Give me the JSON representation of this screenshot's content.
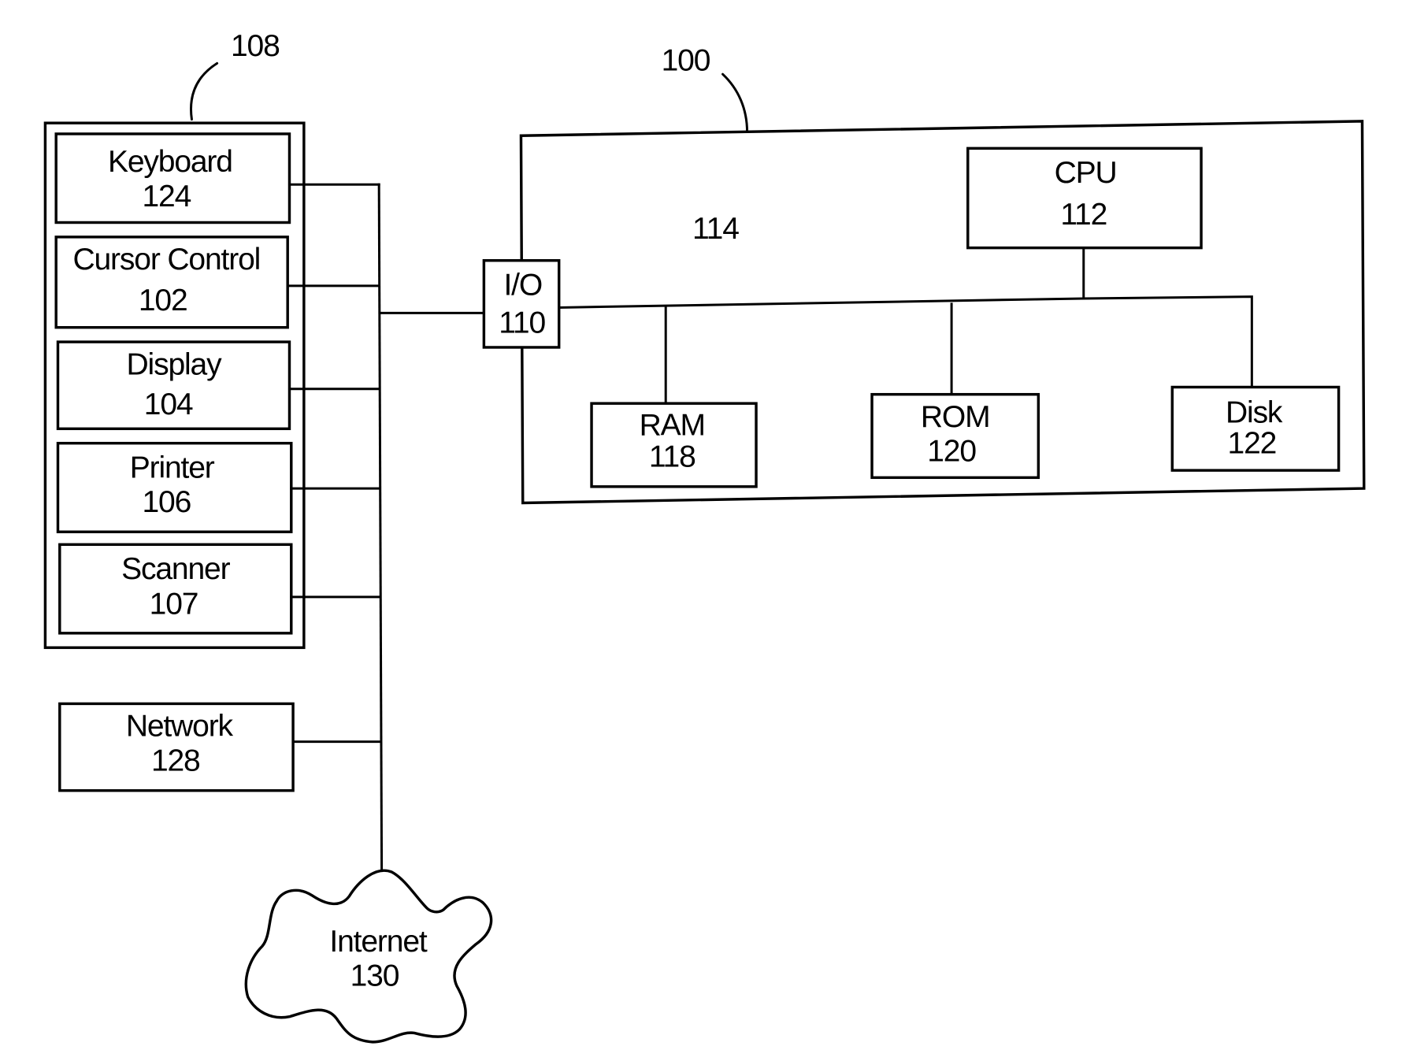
{
  "figure": {
    "system_ref": "100",
    "peripherals_group_ref": "108",
    "bus_ref": "114"
  },
  "peripherals": [
    {
      "name": "Keyboard",
      "ref": "124"
    },
    {
      "name": "Cursor Control",
      "ref": "102"
    },
    {
      "name": "Display",
      "ref": "104"
    },
    {
      "name": "Printer",
      "ref": "106"
    },
    {
      "name": "Scanner",
      "ref": "107"
    }
  ],
  "network": {
    "name": "Network",
    "ref": "128"
  },
  "internet": {
    "name": "Internet",
    "ref": "130"
  },
  "io": {
    "name": "I/O",
    "ref": "110"
  },
  "cpu": {
    "name": "CPU",
    "ref": "112"
  },
  "ram": {
    "name": "RAM",
    "ref": "118"
  },
  "rom": {
    "name": "ROM",
    "ref": "120"
  },
  "disk": {
    "name": "Disk",
    "ref": "122"
  },
  "colors": {
    "stroke": "#000000",
    "background": "#ffffff"
  }
}
